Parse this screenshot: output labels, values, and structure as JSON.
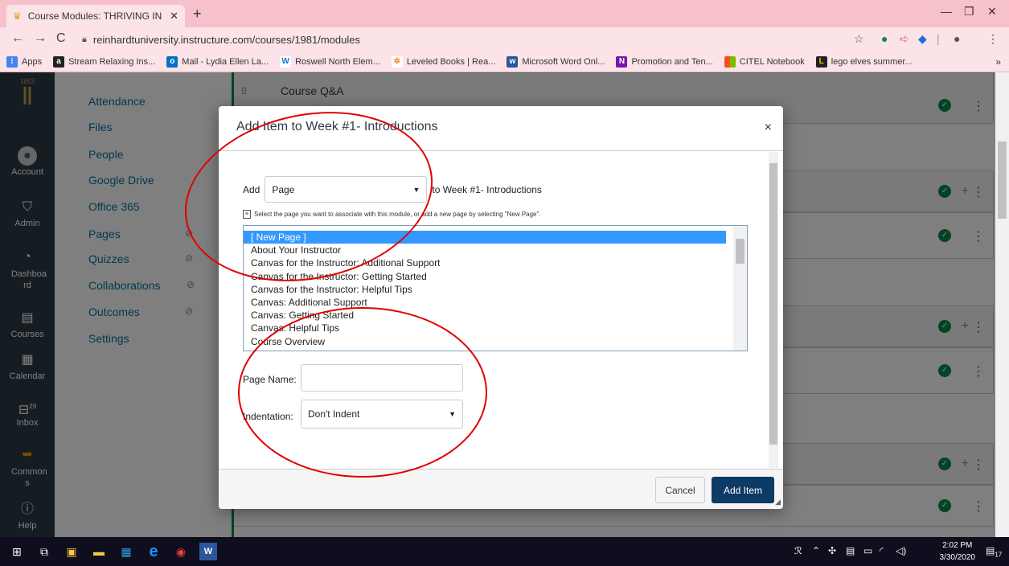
{
  "browser": {
    "tab_title": "Course Modules: THRIVING IN C",
    "url": "reinhardtuniversity.instructure.com/courses/1981/modules",
    "bookmarks": [
      {
        "label": "Apps",
        "icon": "apps-grid-icon",
        "color": "#4285f4"
      },
      {
        "label": "Stream Relaxing Ins...",
        "icon": "a-icon",
        "color": "#222222"
      },
      {
        "label": "Mail - Lydia Ellen La...",
        "icon": "outlook-icon",
        "color": "#0072c6"
      },
      {
        "label": "Roswell North Elem...",
        "icon": "w-logo-icon",
        "color": "#1e6fd9"
      },
      {
        "label": "Leveled Books | Rea...",
        "icon": "star-burst-icon",
        "color": "#ff7f27"
      },
      {
        "label": "Microsoft Word Onl...",
        "icon": "word-icon",
        "color": "#2b579a"
      },
      {
        "label": "Promotion and Ten...",
        "icon": "onenote-icon",
        "color": "#7719aa"
      },
      {
        "label": "CITEL Notebook",
        "icon": "microsoft-logo-icon",
        "color": "#f25022"
      },
      {
        "label": "lego elves summer...",
        "icon": "lego-icon",
        "color": "#222222"
      }
    ],
    "bookmarks_more": "»"
  },
  "global_nav": {
    "logo_year": "1883",
    "items": [
      {
        "label": "Account",
        "icon": "avatar-icon"
      },
      {
        "label": "Admin",
        "icon": "shield-icon"
      },
      {
        "label": "Dashboa rd",
        "icon": "dashboard-icon"
      },
      {
        "label": "Courses",
        "icon": "book-icon"
      },
      {
        "label": "Calendar",
        "icon": "calendar-icon"
      },
      {
        "label": "Inbox",
        "icon": "inbox-icon"
      },
      {
        "label": "Common s",
        "icon": "commons-icon"
      },
      {
        "label": "Help",
        "icon": "help-icon"
      }
    ],
    "inbox_badge": "29"
  },
  "course_nav": {
    "items": [
      {
        "label": "Attendance",
        "hidden": false
      },
      {
        "label": "Files",
        "hidden": false
      },
      {
        "label": "People",
        "hidden": false
      },
      {
        "label": "Google Drive",
        "hidden": false
      },
      {
        "label": "Office 365",
        "hidden": false
      },
      {
        "label": "Pages",
        "hidden": true
      },
      {
        "label": "Quizzes",
        "hidden": true
      },
      {
        "label": "Collaborations",
        "hidden": true
      },
      {
        "label": "Outcomes",
        "hidden": true
      },
      {
        "label": "Settings",
        "hidden": false
      }
    ]
  },
  "modules": {
    "first_item": "Course Q&A"
  },
  "dialog": {
    "title": "Add Item to Week #1- Introductions",
    "close": "×",
    "add_label": "Add",
    "item_type": "Page",
    "to_label": "to Week #1- Introductions",
    "hint": "Select the page you want to associate with this module, or add a new page by selecting \"New Page\".",
    "pages": [
      "[ New Page ]",
      "About Your Instructor",
      "Canvas for the Instructor: Additional Support",
      "Canvas for the Instructor: Getting Started",
      "Canvas for the Instructor: Helpful Tips",
      "Canvas: Additional Support",
      "Canvas: Getting Started",
      "Canvas: Helpful Tips",
      "Course Overview"
    ],
    "page_name_label": "Page Name:",
    "page_name_value": "",
    "indentation_label": "Indentation:",
    "indentation_value": "Don't Indent",
    "cancel": "Cancel",
    "add_item": "Add Item"
  },
  "taskbar": {
    "time": "2:02 PM",
    "date": "3/30/2020",
    "notifications": "17"
  },
  "colors": {
    "tab_strip": "#f7c1cb",
    "canvas_nav": "#2d3b45",
    "link": "#0770a3",
    "primary_button": "#0e3a66",
    "annotation": "#e00000"
  }
}
